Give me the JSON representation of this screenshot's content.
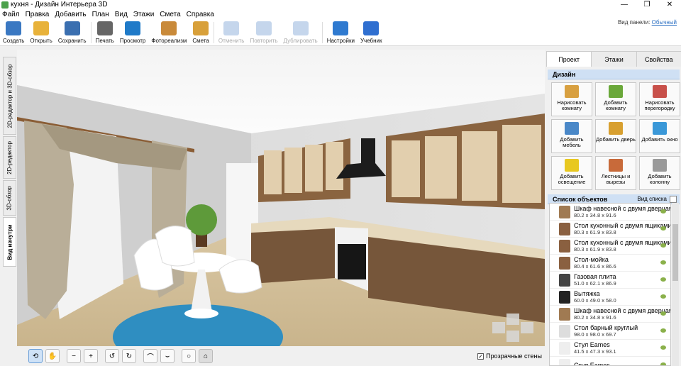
{
  "window": {
    "title": "кухня - Дизайн Интерьера 3D"
  },
  "menu": [
    "Файл",
    "Правка",
    "Добавить",
    "План",
    "Вид",
    "Этажи",
    "Смета",
    "Справка"
  ],
  "toolbar": [
    {
      "label": "Создать",
      "icon": "new-file-icon",
      "color": "#3a78c2",
      "disabled": false
    },
    {
      "label": "Открыть",
      "icon": "folder-icon",
      "color": "#e8b23a",
      "disabled": false
    },
    {
      "label": "Сохранить",
      "icon": "save-icon",
      "color": "#3a6fb0",
      "disabled": false
    },
    {
      "label": "Печать",
      "icon": "printer-icon",
      "color": "#666666",
      "disabled": false
    },
    {
      "label": "Просмотр",
      "icon": "monitor-icon",
      "color": "#1f7ac8",
      "disabled": false
    },
    {
      "label": "Фотореализм",
      "icon": "photo-icon",
      "color": "#c98a3a",
      "disabled": false
    },
    {
      "label": "Смета",
      "icon": "notepad-icon",
      "color": "#d8a03a",
      "disabled": false
    },
    {
      "label": "Отменить",
      "icon": "undo-icon",
      "color": "#5a8ac8",
      "disabled": true
    },
    {
      "label": "Повторить",
      "icon": "redo-icon",
      "color": "#5a8ac8",
      "disabled": true
    },
    {
      "label": "Дублировать",
      "icon": "duplicate-icon",
      "color": "#5a8ac8",
      "disabled": true
    },
    {
      "label": "Настройки",
      "icon": "gear-icon",
      "color": "#2f7ad0",
      "disabled": false
    },
    {
      "label": "Учебник",
      "icon": "help-icon",
      "color": "#2f6fd0",
      "disabled": false
    }
  ],
  "panel_view": {
    "label": "Вид панели:",
    "value": "Обычный"
  },
  "left_tabs": [
    {
      "label": "2D-редактор и 3D-обзор",
      "active": false
    },
    {
      "label": "2D-редактор",
      "active": false
    },
    {
      "label": "3D-обзор",
      "active": false
    },
    {
      "label": "Вид изнутри",
      "active": true
    }
  ],
  "right_tabs": [
    {
      "label": "Проект",
      "active": true
    },
    {
      "label": "Этажи",
      "active": false
    },
    {
      "label": "Свойства",
      "active": false
    }
  ],
  "design": {
    "title": "Дизайн",
    "buttons": [
      {
        "label": "Нарисовать комнату",
        "icon": "wall-brush-icon",
        "color": "#d8a040"
      },
      {
        "label": "Добавить комнату",
        "icon": "add-room-icon",
        "color": "#6aa83a"
      },
      {
        "label": "Нарисовать перегородку",
        "icon": "brick-wall-icon",
        "color": "#c8504a"
      },
      {
        "label": "Добавить мебель",
        "icon": "armchair-icon",
        "color": "#4a88c8"
      },
      {
        "label": "Добавить дверь",
        "icon": "door-icon",
        "color": "#d8a030"
      },
      {
        "label": "Добавить окно",
        "icon": "window-icon",
        "color": "#3a98d8"
      },
      {
        "label": "Добавить освещение",
        "icon": "bulb-icon",
        "color": "#e8c820"
      },
      {
        "label": "Лестницы и вырезы",
        "icon": "stairs-icon",
        "color": "#c86a3a"
      },
      {
        "label": "Добавить колонну",
        "icon": "column-icon",
        "color": "#9a9a9a"
      }
    ]
  },
  "objects": {
    "title": "Список объектов",
    "view_label": "Вид списка",
    "items": [
      {
        "name": "Шкаф навесной с двумя дверцами",
        "dims": "80.2 x 34.8 x 91.6",
        "color": "#a07a52"
      },
      {
        "name": "Стол кухонный с двумя ящиками",
        "dims": "80.3 x 61.9 x 83.8",
        "color": "#8a6040"
      },
      {
        "name": "Стол кухонный с двумя ящиками",
        "dims": "80.3 x 61.9 x 83.8",
        "color": "#8a6040"
      },
      {
        "name": "Стол-мойка",
        "dims": "80.4 x 61.6 x 86.6",
        "color": "#8a6040"
      },
      {
        "name": "Газовая плита",
        "dims": "51.0 x 62.1 x 86.9",
        "color": "#444444"
      },
      {
        "name": "Вытяжка",
        "dims": "60.0 x 49.0 x 58.0",
        "color": "#222222"
      },
      {
        "name": "Шкаф навесной с двумя дверцами",
        "dims": "80.2 x 34.8 x 91.6",
        "color": "#a07a52"
      },
      {
        "name": "Стол барный круглый",
        "dims": "98.0 x 98.0 x 69.7",
        "color": "#dddddd"
      },
      {
        "name": "Стул Eames",
        "dims": "41.5 x 47.3 x 93.1",
        "color": "#eeeeee"
      },
      {
        "name": "Стул Eames",
        "dims": "",
        "color": "#eeeeee"
      }
    ]
  },
  "bottom": {
    "transparent_walls": "Прозрачные стены",
    "checked": true
  }
}
